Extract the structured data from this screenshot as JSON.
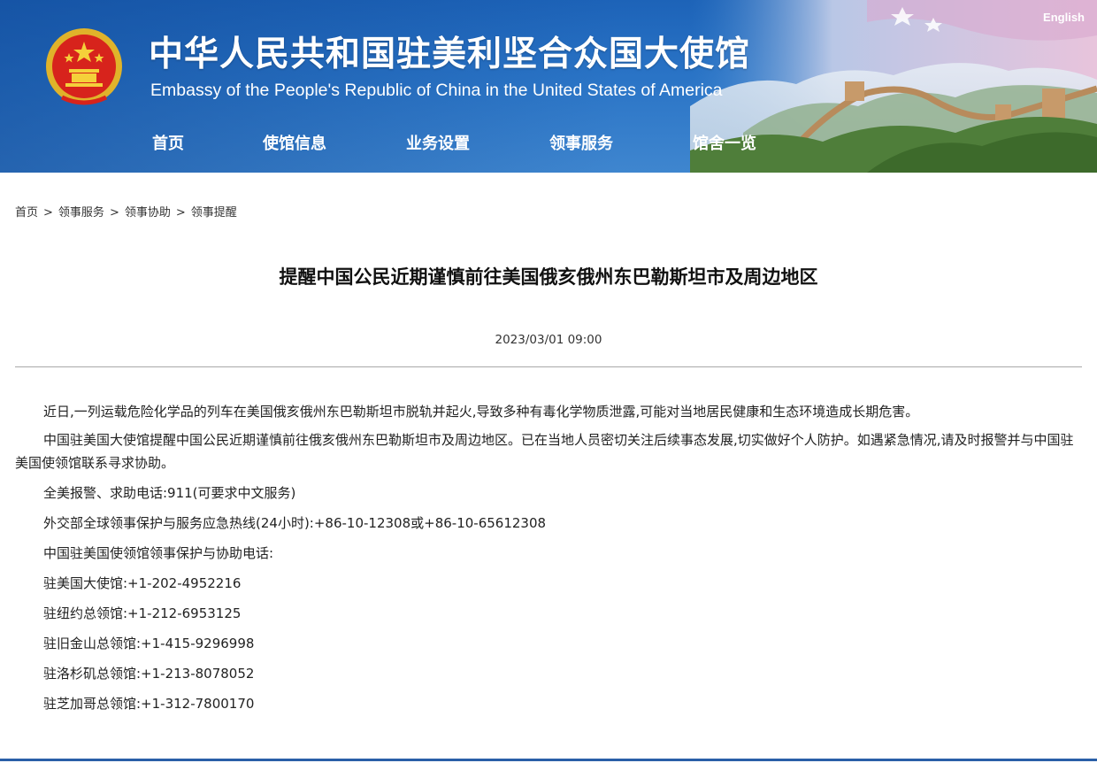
{
  "header": {
    "title_cn": "中华人民共和国驻美利坚合众国大使馆",
    "title_en": "Embassy of the People's Republic of China in the United States of America",
    "lang_link": "English",
    "emblem_icon": "national-emblem-icon",
    "colors": {
      "banner": "#2a74c6",
      "text": "#ffffff"
    }
  },
  "nav": {
    "items": [
      {
        "label": "首页"
      },
      {
        "label": "使馆信息"
      },
      {
        "label": "业务设置"
      },
      {
        "label": "领事服务"
      },
      {
        "label": "馆舍一览"
      }
    ]
  },
  "breadcrumb": {
    "items": [
      "首页",
      "领事服务",
      "领事协助",
      "领事提醒"
    ],
    "separator": ">"
  },
  "article": {
    "title": "提醒中国公民近期谨慎前往美国俄亥俄州东巴勒斯坦市及周边地区",
    "date": "2023/03/01 09:00",
    "paragraphs": [
      "近日,一列运载危险化学品的列车在美国俄亥俄州东巴勒斯坦市脱轨并起火,导致多种有毒化学物质泄露,可能对当地居民健康和生态环境造成长期危害。",
      "中国驻美国大使馆提醒中国公民近期谨慎前往俄亥俄州东巴勒斯坦市及周边地区。已在当地人员密切关注后续事态发展,切实做好个人防护。如遇紧急情况,请及时报警并与中国驻美国使领馆联系寻求协助。",
      "全美报警、求助电话:911(可要求中文服务)",
      "外交部全球领事保护与服务应急热线(24小时):+86-10-12308或+86-10-65612308",
      "中国驻美国使领馆领事保护与协助电话:",
      "驻美国大使馆:+1-202-4952216",
      "驻纽约总领馆:+1-212-6953125",
      "驻旧金山总领馆:+1-415-9296998",
      "驻洛杉矶总领馆:+1-213-8078052",
      "驻芝加哥总领馆:+1-312-7800170"
    ]
  }
}
